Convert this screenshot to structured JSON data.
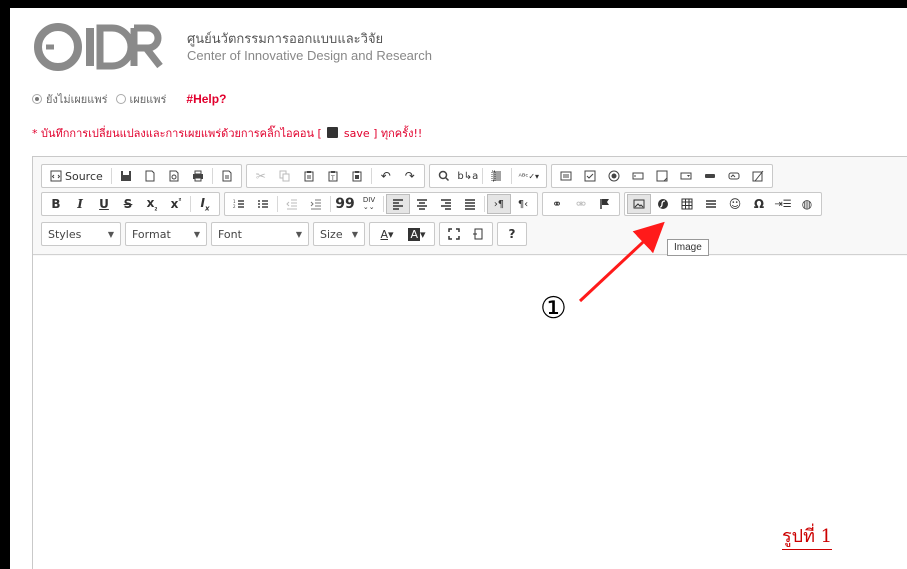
{
  "header": {
    "org_name_th": "ศูนย์นวัตกรรมการออกแบบและวิจัย",
    "org_name_en": "Center of Innovative Design and Research",
    "logo_text": "CIDR"
  },
  "publish": {
    "unpublished_label": "ยังไม่เผยแพร่",
    "published_label": "เผยแพร่",
    "help_link": "#Help?"
  },
  "note": {
    "before": "* บันทึกการเปลี่ยนแปลงและการเผยแพร่ด้วยการคลิ๊กไอคอน [",
    "save_word": "save",
    "after": "] ทุกครั้ง!!"
  },
  "toolbar": {
    "source_label": "Source",
    "styles_label": "Styles",
    "format_label": "Format",
    "font_label": "Font",
    "size_label": "Size",
    "help_symbol": "?"
  },
  "tooltip": {
    "text": "Image"
  },
  "annotation": {
    "step_number": "①",
    "figure_caption": "รูปที่ 1",
    "arrow_color": "#ff1a1a"
  },
  "colors": {
    "accent_red": "#e1002d",
    "toolbar_bg": "#f8f8f8"
  }
}
